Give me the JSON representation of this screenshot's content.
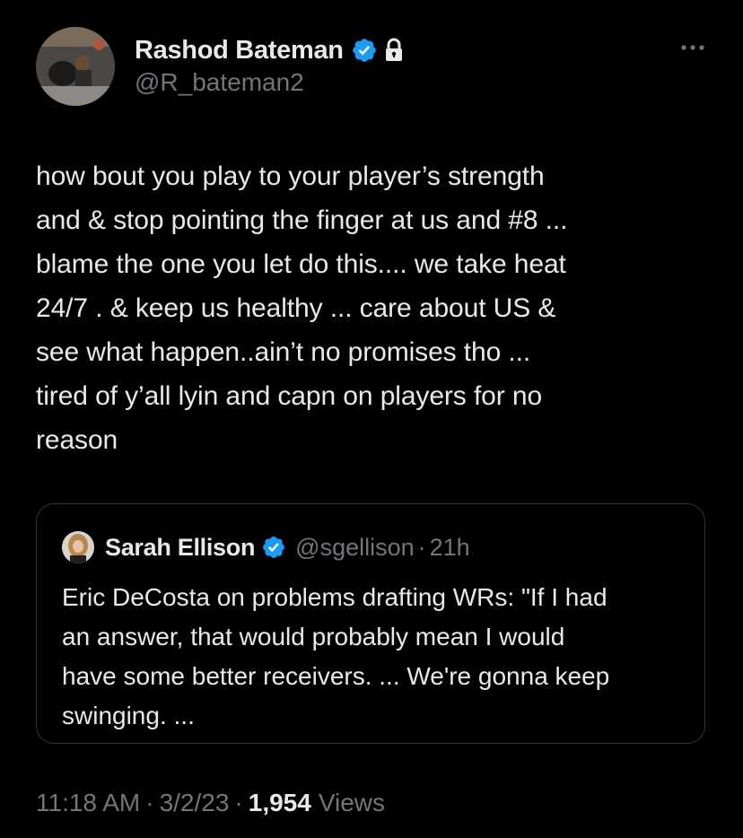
{
  "author": {
    "display_name": "Rashod Bateman",
    "handle": "@R_bateman2",
    "avatar_icon": "profile-photo",
    "verified_icon": "verified-badge-icon",
    "lock_icon": "lock-icon"
  },
  "tweet": {
    "text": "how bout you play to your player’s strength\nand & stop pointing the finger at us and #8 ...\nblame the one you let do this.... we take heat\n24/7 . & keep us healthy ... care about US &\nsee what happen..ain’t no promises tho ...\ntired of y’all lyin and capn on players for no\nreason"
  },
  "quote": {
    "display_name": "Sarah Ellison",
    "handle": "@sgellison",
    "separator": "·",
    "time": "21h",
    "text": "Eric DeCosta on problems drafting WRs: \"If I had\nan answer, that would probably mean I would\nhave some better receivers. ... We're gonna keep\nswinging. ..."
  },
  "meta": {
    "time": "11:18 AM",
    "separator": "·",
    "date": "3/2/23",
    "views_count": "1,954",
    "views_label": "Views"
  },
  "colors": {
    "background": "#000000",
    "text_primary": "#e7e9ea",
    "text_secondary": "#71767b",
    "verified_blue": "#1d9bf0",
    "border": "#2f3336"
  }
}
